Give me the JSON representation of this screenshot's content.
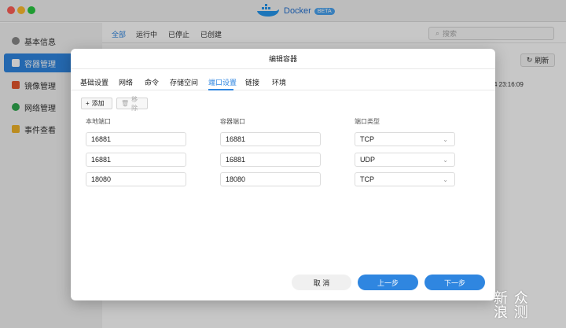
{
  "app": {
    "title": "Docker",
    "badge": "BETA"
  },
  "sidebar": {
    "items": [
      {
        "label": "基本信息",
        "icon": "settings-icon",
        "active": false
      },
      {
        "label": "容器管理",
        "icon": "cube-icon",
        "active": true
      },
      {
        "label": "镜像管理",
        "icon": "image-icon",
        "active": false
      },
      {
        "label": "网络管理",
        "icon": "globe-icon",
        "active": false
      },
      {
        "label": "事件查看",
        "icon": "folder-icon",
        "active": false
      }
    ]
  },
  "main": {
    "tabs": [
      "全部",
      "运行中",
      "已停止",
      "已创建"
    ],
    "search_placeholder": "搜索",
    "refresh_label": "刷新",
    "row_date": "4 23:16:09"
  },
  "modal": {
    "title": "编辑容器",
    "tabs": [
      "基础设置",
      "网络",
      "命令",
      "存储空间",
      "端口设置",
      "链接",
      "环境"
    ],
    "active_tab": "端口设置",
    "add_label": "添加",
    "delete_label": "移除",
    "columns": [
      "本地端口",
      "容器端口",
      "端口类型"
    ],
    "ports": [
      {
        "local": "16881",
        "container": "16881",
        "type": "TCP"
      },
      {
        "local": "16881",
        "container": "16881",
        "type": "UDP"
      },
      {
        "local": "18080",
        "container": "18080",
        "type": "TCP"
      }
    ],
    "cancel_label": "取 消",
    "prev_label": "上一步",
    "next_label": "下一步"
  },
  "watermark": {
    "line1": "新 众",
    "line2": "浪 测"
  },
  "colors": {
    "accent": "#2f86e0",
    "close": "#ff5f57",
    "minimize": "#febc2e",
    "maximize": "#28c840"
  }
}
